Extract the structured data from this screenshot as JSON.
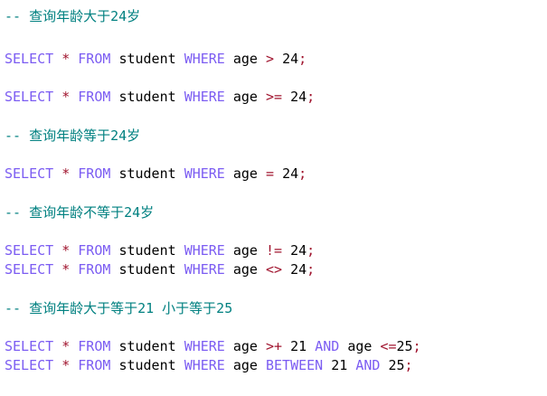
{
  "colors": {
    "comment": "#008080",
    "keyword": "#7b5cf2",
    "operator": "#a0142e",
    "identifier": "#000000"
  },
  "lines": [
    {
      "comment": "-- 查询年龄大于24岁"
    },
    {
      "kw1": "SELECT",
      "star": "*",
      "kw2": "FROM",
      "table": "student",
      "kw3": "WHERE",
      "col": "age",
      "op": ">",
      "val": "24",
      "end": ";"
    },
    {
      "kw1": "SELECT",
      "star": "*",
      "kw2": "FROM",
      "table": "student",
      "kw3": "WHERE",
      "col": "age",
      "op": ">=",
      "val": "24",
      "end": ";"
    },
    {
      "comment": "-- 查询年龄等于24岁"
    },
    {
      "kw1": "SELECT",
      "star": "*",
      "kw2": "FROM",
      "table": "student",
      "kw3": "WHERE",
      "col": "age",
      "op": "=",
      "val": "24",
      "end": ";"
    },
    {
      "comment": "-- 查询年龄不等于24岁"
    },
    {
      "kw1": "SELECT",
      "star": "*",
      "kw2": "FROM",
      "table": "student",
      "kw3": "WHERE",
      "col": "age",
      "op": "!=",
      "val": "24",
      "end": ";"
    },
    {
      "kw1": "SELECT",
      "star": "*",
      "kw2": "FROM",
      "table": "student",
      "kw3": "WHERE",
      "col": "age",
      "op": "<>",
      "val": "24",
      "end": ";"
    },
    {
      "comment": "-- 查询年龄大于等于21 小于等于25"
    },
    {
      "kw1": "SELECT",
      "star": "*",
      "kw2": "FROM",
      "table": "student",
      "kw3": "WHERE",
      "col": "age",
      "op": ">+",
      "val": "21",
      "kw4": "AND",
      "col2": "age",
      "op2": "<=",
      "val2": "25",
      "end": ";"
    },
    {
      "kw1": "SELECT",
      "star": "*",
      "kw2": "FROM",
      "table": "student",
      "kw3": "WHERE",
      "col": "age",
      "kw5": "BETWEEN",
      "val": "21",
      "kw4": "AND",
      "val2": "25",
      "end": ";"
    }
  ]
}
